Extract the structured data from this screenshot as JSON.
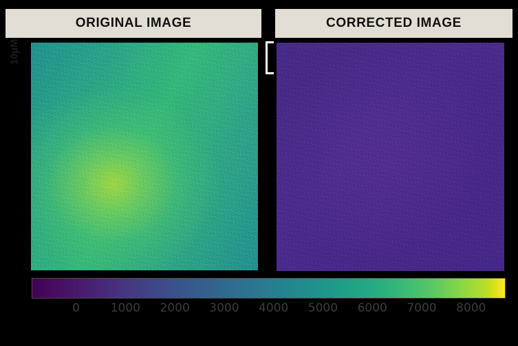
{
  "figure": {
    "background_color": "#000000",
    "panels": [
      {
        "id": "original",
        "title": "ORIGINAL IMAGE",
        "title_bg": "#e3ded5",
        "title_color": "#111111",
        "scalebar_label": "10μM",
        "scalebar_color": "#000000",
        "description": "Uneven illumination field, bright center-left vignette"
      },
      {
        "id": "corrected",
        "title": "CORRECTED IMAGE",
        "title_bg": "#e3ded5",
        "title_color": "#111111",
        "scalebar_label": "",
        "scalebar_color": "#ffffff",
        "description": "Flat-field corrected, uniform low signal"
      }
    ]
  },
  "colorbar": {
    "colormap": "viridis",
    "orientation": "horizontal",
    "tick_labels": [
      "0",
      "1000",
      "2000",
      "3000",
      "4000",
      "5000",
      "6000",
      "7000",
      "8000"
    ],
    "tick_values": [
      0,
      1000,
      2000,
      3000,
      4000,
      5000,
      6000,
      7000,
      8000
    ],
    "tick_color": "#3c3c3c",
    "vmin": -900,
    "vmax": 8700
  },
  "chart_data": {
    "type": "heatmap",
    "title": "",
    "subtitle": "",
    "xlabel": "",
    "ylabel": "",
    "colormap": "viridis",
    "colorbar_label": "",
    "colorbar_ticks": [
      0,
      1000,
      2000,
      3000,
      4000,
      5000,
      6000,
      7000,
      8000
    ],
    "vmin": -900,
    "vmax": 8700,
    "grid": false,
    "legend_position": "none",
    "annotations": [
      "10μM scale bar on both panels"
    ],
    "panels": [
      {
        "name": "ORIGINAL IMAGE",
        "intensity_center": 5600,
        "intensity_corner": 3900,
        "intensity_edge_mean": 4300,
        "noise_sigma": 260,
        "field_profile": "radial vignette peaking near 36% width, 62% height"
      },
      {
        "name": "CORRECTED IMAGE",
        "intensity_center": 750,
        "intensity_corner": 700,
        "intensity_edge_mean": 720,
        "noise_sigma": 180,
        "field_profile": "flat / uniform"
      }
    ]
  }
}
